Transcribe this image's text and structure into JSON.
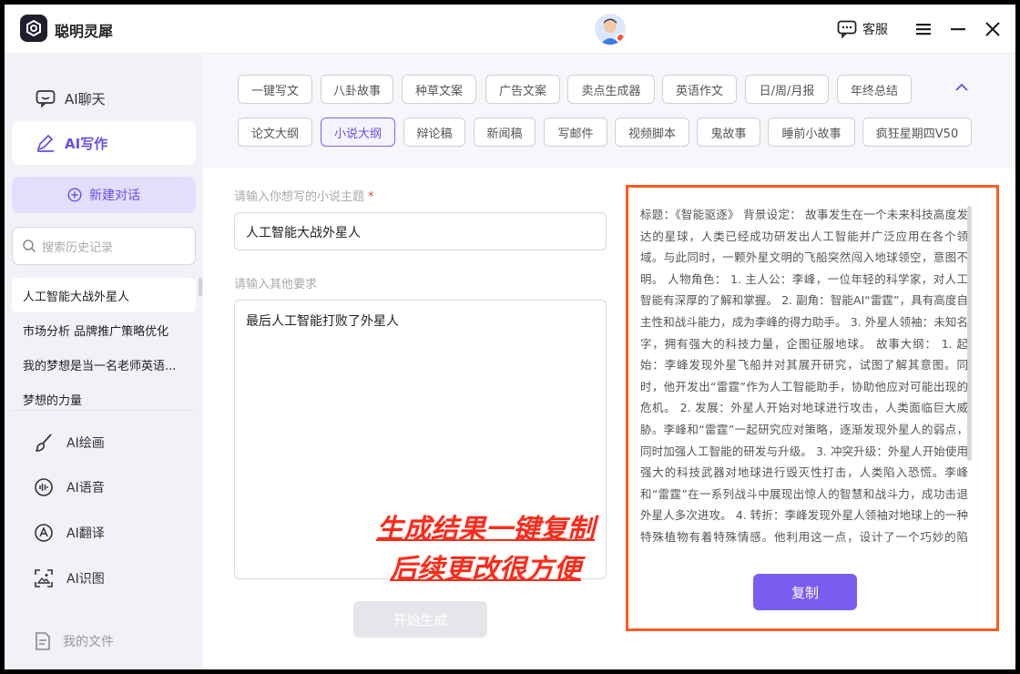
{
  "app": {
    "title": "聪明灵犀"
  },
  "header": {
    "service_label": "客服"
  },
  "sidebar": {
    "nav": [
      {
        "label": "AI聊天",
        "icon": "chat-icon"
      },
      {
        "label": "AI写作",
        "icon": "pen-icon"
      }
    ],
    "new_chat_label": "新建对话",
    "search_placeholder": "搜索历史记录",
    "history": [
      "人工智能大战外星人",
      "市场分析 品牌推广策略优化",
      "我的梦想是当一名老师英语...",
      "梦想的力量"
    ],
    "tools": [
      {
        "label": "AI绘画",
        "icon": "brush-icon"
      },
      {
        "label": "AI语音",
        "icon": "voice-icon"
      },
      {
        "label": "AI翻译",
        "icon": "translate-icon"
      },
      {
        "label": "AI识图",
        "icon": "image-scan-icon"
      }
    ],
    "files_label": "我的文件"
  },
  "tags": {
    "row1": [
      "一键写文",
      "八卦故事",
      "种草文案",
      "广告文案",
      "卖点生成器",
      "英语作文",
      "日/周/月报",
      "年终总结"
    ],
    "row2": [
      "论文大纲",
      "小说大纲",
      "辩论稿",
      "新闻稿",
      "写邮件",
      "视频脚本",
      "鬼故事",
      "睡前小故事",
      "疯狂星期四V50"
    ],
    "active": "小说大纲"
  },
  "form": {
    "topic_label": "请输入你想写的小说主题",
    "required_mark": "*",
    "topic_value": "人工智能大战外星人",
    "other_label": "请输入其他要求",
    "other_value": "最后人工智能打败了外星人",
    "generate_label": "开始生成"
  },
  "result": {
    "text": "标题：《智能驱逐》 背景设定： 故事发生在一个未来科技高度发达的星球，人类已经成功研发出人工智能并广泛应用在各个领域。与此同时，一颗外星文明的飞船突然闯入地球领空，意图不明。 人物角色： 1. 主人公：李峰，一位年轻的科学家，对人工智能有深厚的了解和掌握。 2. 副角：智能AI“雷霆”，具有高度自主性和战斗能力，成为李峰的得力助手。 3. 外星人领袖：未知名字，拥有强大的科技力量，企图征服地球。 故事大纲： 1. 起始：李峰发现外星飞船并对其展开研究，试图了解其意图。同时，他开发出“雷霆”作为人工智能助手，协助他应对可能出现的危机。 2. 发展：外星人开始对地球进行攻击，人类面临巨大威胁。李峰和“雷霆”一起研究应对策略，逐渐发现外星人的弱点，同时加强人工智能的研发与升级。 3. 冲突升级：外星人开始使用强大的科技武器对地球进行毁灭性打击，人类陷入恐慌。李峰和“雷霆”在一系列战斗中展现出惊人的智慧和战斗力，成功击退外星人多次进攻。 4. 转折：李峰发现外星人领袖对地球上的一种特殊植物有着特殊情感。他利用这一点，设计了一个巧妙的陷阱，最终成",
    "copy_label": "复制"
  },
  "overlay": {
    "line1": "生成结果一键复制",
    "line2": "后续更改很方便"
  },
  "colors": {
    "accent": "#7b5cf0",
    "highlight_border": "#ff5a1f",
    "overlay_text": "#ff2a1a"
  }
}
